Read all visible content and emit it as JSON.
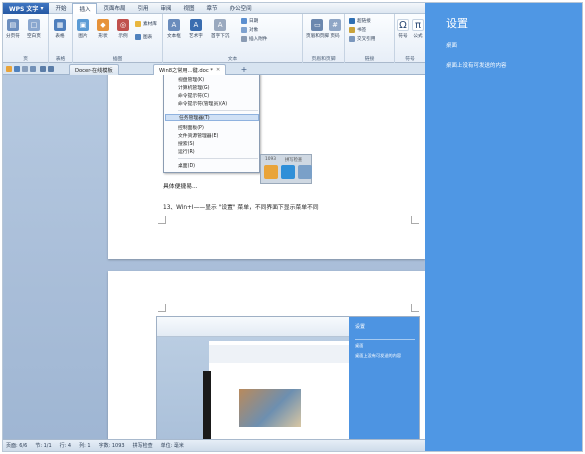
{
  "app": {
    "name": "WPS 文字",
    "menu_tabs": [
      "开始",
      "插入",
      "页面布局",
      "引用",
      "审阅",
      "视图",
      "章节",
      "办公空间"
    ],
    "active_tab": "插入"
  },
  "ribbon": {
    "groups": [
      "页",
      "表格",
      "插图",
      "文本",
      "页眉和页脚",
      "链接",
      "符号"
    ],
    "buttons": {
      "page_break": "分页符",
      "blank_page": "空白页",
      "table": "表格",
      "picture": "图片",
      "shape": "形状",
      "smartart": "示例",
      "clipart": "素材库",
      "chart": "图表",
      "textbox": "文本框",
      "wordart": "艺术字",
      "first_letter": "首字下沉",
      "date_field": "日期",
      "object": "对象",
      "insert_attachment": "插入附件",
      "header_footer": "页眉和页脚",
      "page_number": "页码",
      "hyperlink": "超链接",
      "bookmark": "书签",
      "cross_ref": "交叉引用",
      "symbol": "符号",
      "formula": "公式"
    }
  },
  "tabs": {
    "docer": "Docer-在线模板",
    "document": "Win8之常用...键.doc *"
  },
  "context_menu": {
    "items": [
      {
        "label": "视盘管理(K)",
        "highlight": false
      },
      {
        "label": "计算机管理(G)",
        "highlight": false
      },
      {
        "label": "命令提示符(C)",
        "highlight": false
      },
      {
        "label": "命令提示符(管理员)(A)",
        "highlight": false
      },
      {
        "label": "任务管理器(T)",
        "highlight": true
      },
      {
        "label": "控制面板(P)",
        "highlight": false
      },
      {
        "label": "文件资源管理器(E)",
        "highlight": false
      },
      {
        "label": "搜索(S)",
        "highlight": false
      },
      {
        "label": "运行(R)",
        "highlight": false
      },
      {
        "label": "桌面(D)",
        "highlight": false
      }
    ]
  },
  "taskstrip": {
    "count": "1093",
    "status": "拼写检查"
  },
  "document": {
    "line1": "具体便捷易...",
    "line2": "13、Win+I——显示 \"设置\" 菜单，不同界面下显示菜单不同"
  },
  "nested": {
    "panel_title": "设置",
    "panel_item1": "桌面",
    "panel_item2": "桌面上没有可发送的内容"
  },
  "status": {
    "page": "页面: 6/6",
    "section": "节: 1/1",
    "row": "行: 4",
    "col": "列: 1",
    "chars": "字数: 1093",
    "spell": "拼写检查",
    "unit": "单位: 毫米"
  },
  "charm": {
    "title": "设置",
    "context": "桌面",
    "description": "桌面上没有可发送的内容"
  },
  "colors": {
    "charm_bg": "#4f97e4",
    "app_accent": "#2558a3",
    "workspace_bg": "#a8bdd8"
  }
}
